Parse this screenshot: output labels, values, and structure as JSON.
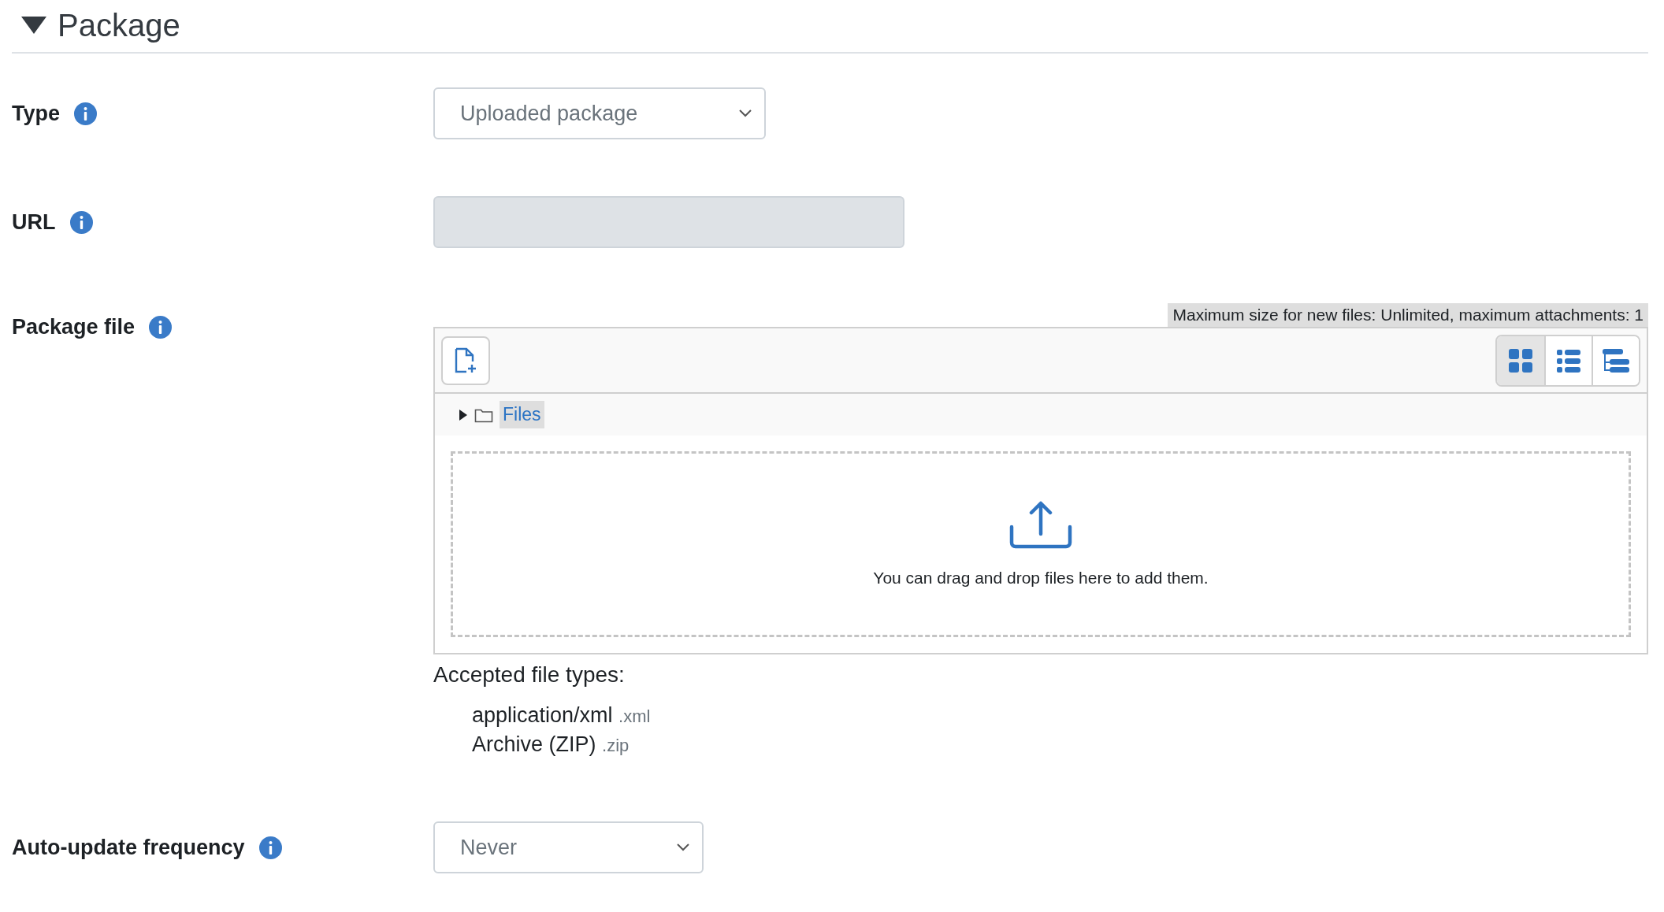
{
  "section": {
    "title": "Package",
    "expanded": true
  },
  "type_field": {
    "label": "Type",
    "value": "Uploaded package"
  },
  "url_field": {
    "label": "URL",
    "disabled": true
  },
  "package_file": {
    "label": "Package file",
    "limits": "Maximum size for new files: Unlimited, maximum attachments: 1",
    "views": [
      {
        "kind": "grid",
        "selected": true
      },
      {
        "kind": "list",
        "selected": false
      },
      {
        "kind": "tree",
        "selected": false
      }
    ],
    "folder": {
      "label": "Files",
      "expanded": false,
      "selected": true
    },
    "dropzone_text": "You can drag and drop files here to add them.",
    "accepted_title": "Accepted file types:",
    "accepted": [
      {
        "name": "application/xml",
        "ext": ".xml"
      },
      {
        "name": "Archive (ZIP)",
        "ext": ".zip"
      }
    ]
  },
  "frequency_field": {
    "label": "Auto-update frequency",
    "value": "Never"
  }
}
